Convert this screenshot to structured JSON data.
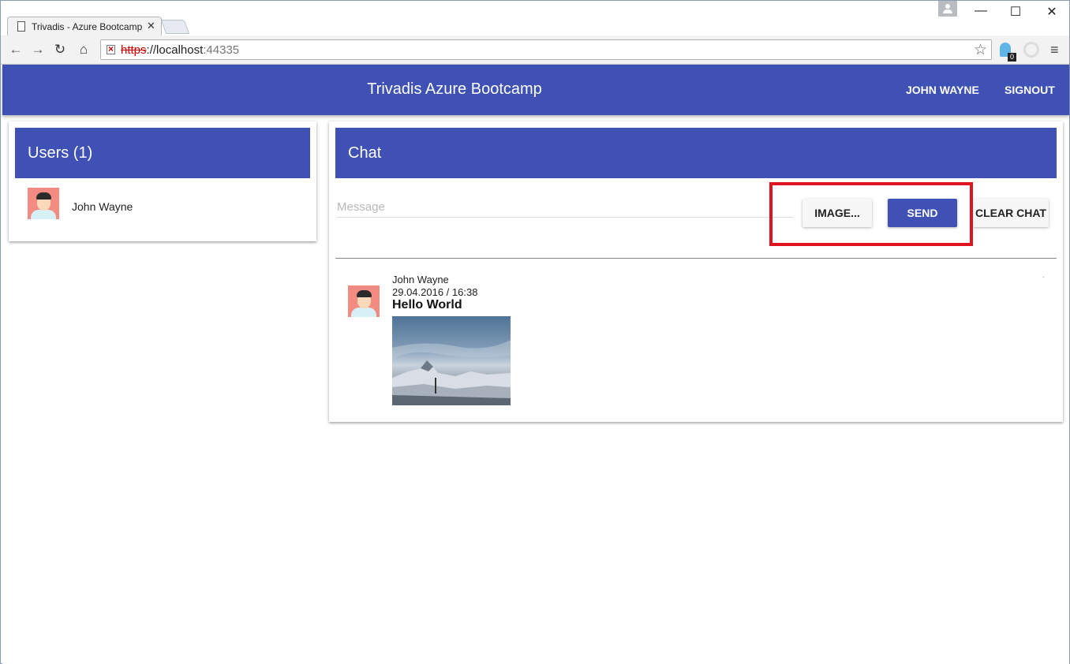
{
  "browser": {
    "tab_title": "Trivadis - Azure Bootcamp",
    "tab_close": "✕",
    "url_scheme": "https",
    "url_sep": "://",
    "url_host": "localhost",
    "url_port": ":44335",
    "back_icon": "←",
    "forward_icon": "→",
    "reload_icon": "↻",
    "home_icon": "⌂",
    "star_icon": "☆",
    "menu_icon": "≡",
    "minimize_icon": "—",
    "maximize_icon": "☐",
    "close_icon": "✕",
    "extension_badge": "0"
  },
  "header": {
    "title": "Trivadis Azure Bootcamp",
    "user": "JOHN WAYNE",
    "signout": "SIGNOUT"
  },
  "users_panel": {
    "title": "Users (1)",
    "users": [
      {
        "name": "John Wayne"
      }
    ]
  },
  "chat_panel": {
    "title": "Chat",
    "message_placeholder": "Message",
    "image_button": "IMAGE...",
    "send_button": "SEND",
    "clear_button": "CLEAR CHAT",
    "messages": [
      {
        "author": "John Wayne",
        "timestamp": "29.04.2016 / 16:38",
        "text": "Hello World",
        "has_image": true,
        "marker": "."
      }
    ]
  },
  "colors": {
    "primary": "#3f51b5",
    "highlight": "#e0141e"
  }
}
